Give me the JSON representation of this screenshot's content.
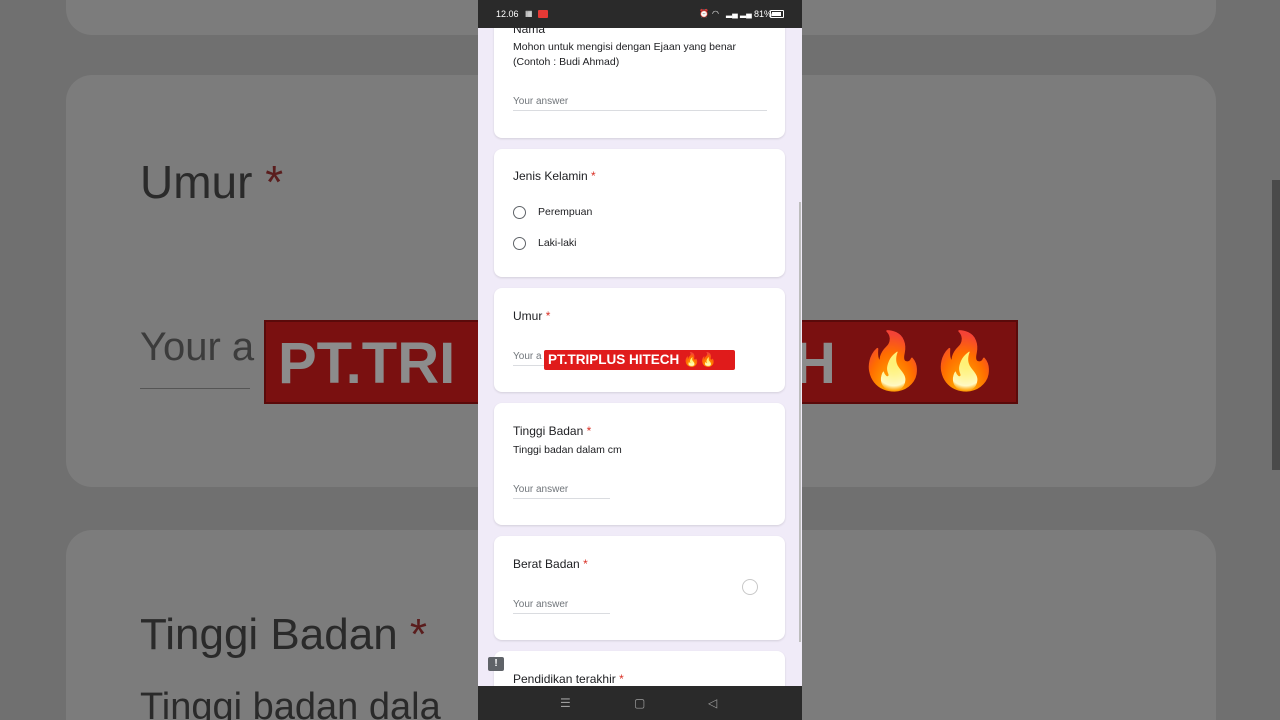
{
  "status_bar": {
    "time": "12.06",
    "icons": [
      "gallery-icon",
      "notification-badge-icon",
      "alarm-icon",
      "wifi-icon",
      "signal-icon",
      "signal-icon-2"
    ],
    "battery": "81%"
  },
  "background": {
    "umur_title": "Umur",
    "umur_star": "*",
    "umur_answer": "Your a",
    "tinggi_title": "Tinggi Badan",
    "tinggi_star": "*",
    "tinggi_desc": "Tinggi badan dala",
    "banner_a": "PT.TRI",
    "banner_b": "H"
  },
  "form": {
    "nama": {
      "title": "Nama",
      "description_line1": "Mohon untuk mengisi dengan Ejaan yang benar",
      "description_line2": "(Contoh : Budi Ahmad)",
      "placeholder": "Your answer"
    },
    "jenis_kelamin": {
      "title": "Jenis Kelamin",
      "required_mark": "*",
      "options": [
        "Perempuan",
        "Laki-laki"
      ]
    },
    "umur": {
      "title": "Umur",
      "required_mark": "*",
      "placeholder": "Your a"
    },
    "tinggi_badan": {
      "title": "Tinggi Badan",
      "required_mark": "*",
      "description": "Tinggi badan dalam cm",
      "placeholder": "Your answer"
    },
    "berat_badan": {
      "title": "Berat Badan",
      "required_mark": "*",
      "placeholder": "Your answer"
    },
    "pendidikan_terakhir": {
      "title": "Pendidikan terakhir",
      "required_mark": "*"
    }
  },
  "overlay_banner": "PT.TRIPLUS HITECH 🔥🔥",
  "feedback_icon": "!",
  "nav_bar": {
    "menu": "☰",
    "home": "▢",
    "back": "◁"
  },
  "colors": {
    "required": "#d93025",
    "banner": "#e01b1b",
    "form_bg": "#f0ebf8"
  }
}
